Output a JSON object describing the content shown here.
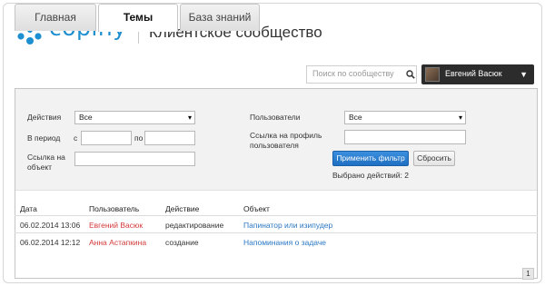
{
  "header": {
    "brand": "copiny",
    "title": "Клиентское сообщество"
  },
  "tabs": [
    {
      "label": "Главная",
      "active": false
    },
    {
      "label": "Темы",
      "active": true
    },
    {
      "label": "База знаний",
      "active": false
    }
  ],
  "search": {
    "placeholder": "Поиск по сообществу"
  },
  "user": {
    "name": "Евгений Васюк"
  },
  "filter": {
    "actions_label": "Действия",
    "actions_value": "Все",
    "period_label": "В период",
    "from_label": "с",
    "to_label": "по",
    "object_link_label": "Ссылка на объект",
    "users_label": "Пользователи",
    "users_value": "Все",
    "profile_link_label": "Ссылка на профиль пользователя",
    "apply_label": "Применить фильтр",
    "reset_label": "Сбросить",
    "selected_text": "Выбрано действий: 2"
  },
  "table": {
    "headers": [
      "Дата",
      "Пользователь",
      "Действие",
      "Объект"
    ],
    "rows": [
      [
        "06.02.2014 13:06",
        "Евгений Васюк",
        "редактирование",
        "Папинатор или изипудер"
      ],
      [
        "06.02.2014 12:12",
        "Анна Астапкина",
        "создание",
        "Напоминания о задаче"
      ]
    ]
  },
  "pager": {
    "current": "1"
  },
  "colors": {
    "accent": "#1e8fd0",
    "user": "#d43a3a",
    "link": "#2b78c5"
  }
}
